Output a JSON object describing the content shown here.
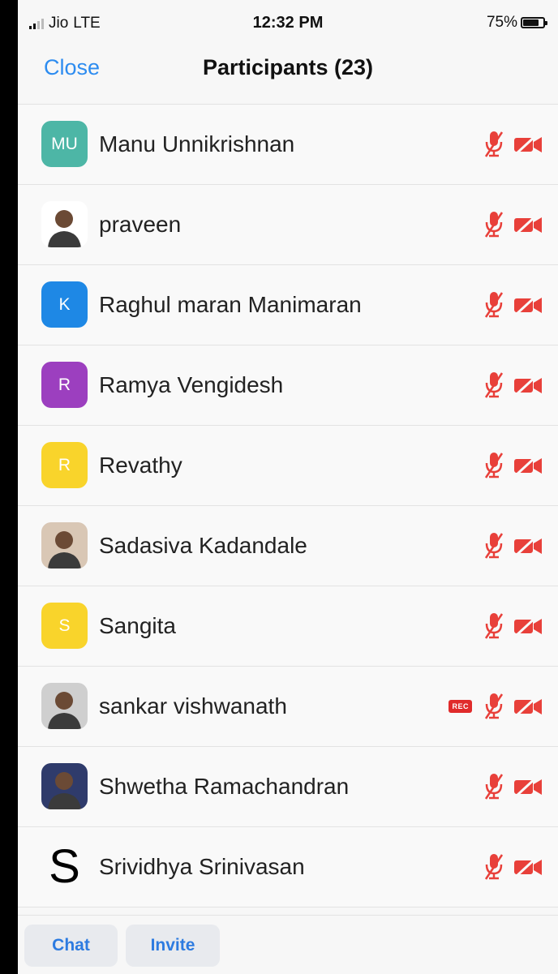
{
  "status_bar": {
    "carrier": "Jio",
    "network": "LTE",
    "time": "12:32 PM",
    "battery": "75%",
    "battery_level": 0.75
  },
  "nav": {
    "close_label": "Close",
    "title": "Participants (23)"
  },
  "participants": [
    {
      "name": "Manu Unnikrishnan",
      "initials": "MU",
      "avatar_color": "#4db6a6",
      "avatar_type": "initials",
      "rec": false
    },
    {
      "name": "praveen",
      "initials": "",
      "avatar_color": "#ffffff",
      "avatar_type": "photo",
      "rec": false
    },
    {
      "name": "Raghul maran Manimaran",
      "initials": "K",
      "avatar_color": "#1e88e5",
      "avatar_type": "initials",
      "rec": false
    },
    {
      "name": "Ramya Vengidesh",
      "initials": "R",
      "avatar_color": "#9c3fbf",
      "avatar_type": "initials",
      "rec": false
    },
    {
      "name": "Revathy",
      "initials": "R",
      "avatar_color": "#f9d42b",
      "avatar_type": "initials",
      "rec": false
    },
    {
      "name": "Sadasiva Kadandale",
      "initials": "",
      "avatar_color": "#d9c7b5",
      "avatar_type": "photo",
      "rec": false
    },
    {
      "name": "Sangita",
      "initials": "S",
      "avatar_color": "#f9d42b",
      "avatar_type": "initials",
      "rec": false
    },
    {
      "name": "sankar vishwanath",
      "initials": "",
      "avatar_color": "#cfcfcf",
      "avatar_type": "photo",
      "rec": true
    },
    {
      "name": "Shwetha Ramachandran",
      "initials": "",
      "avatar_color": "#2f3b6b",
      "avatar_type": "photo",
      "rec": false
    },
    {
      "name": "Srividhya Srinivasan",
      "initials": "S",
      "avatar_color": "transparent",
      "avatar_type": "big-letter",
      "rec": false
    }
  ],
  "rec_label": "REC",
  "icons": {
    "mic": "mic-muted-icon",
    "video": "video-off-icon"
  },
  "colors": {
    "accent": "#2d8cf0",
    "muted_red": "#e8403a"
  },
  "bottom_bar": {
    "chat_label": "Chat",
    "invite_label": "Invite"
  }
}
